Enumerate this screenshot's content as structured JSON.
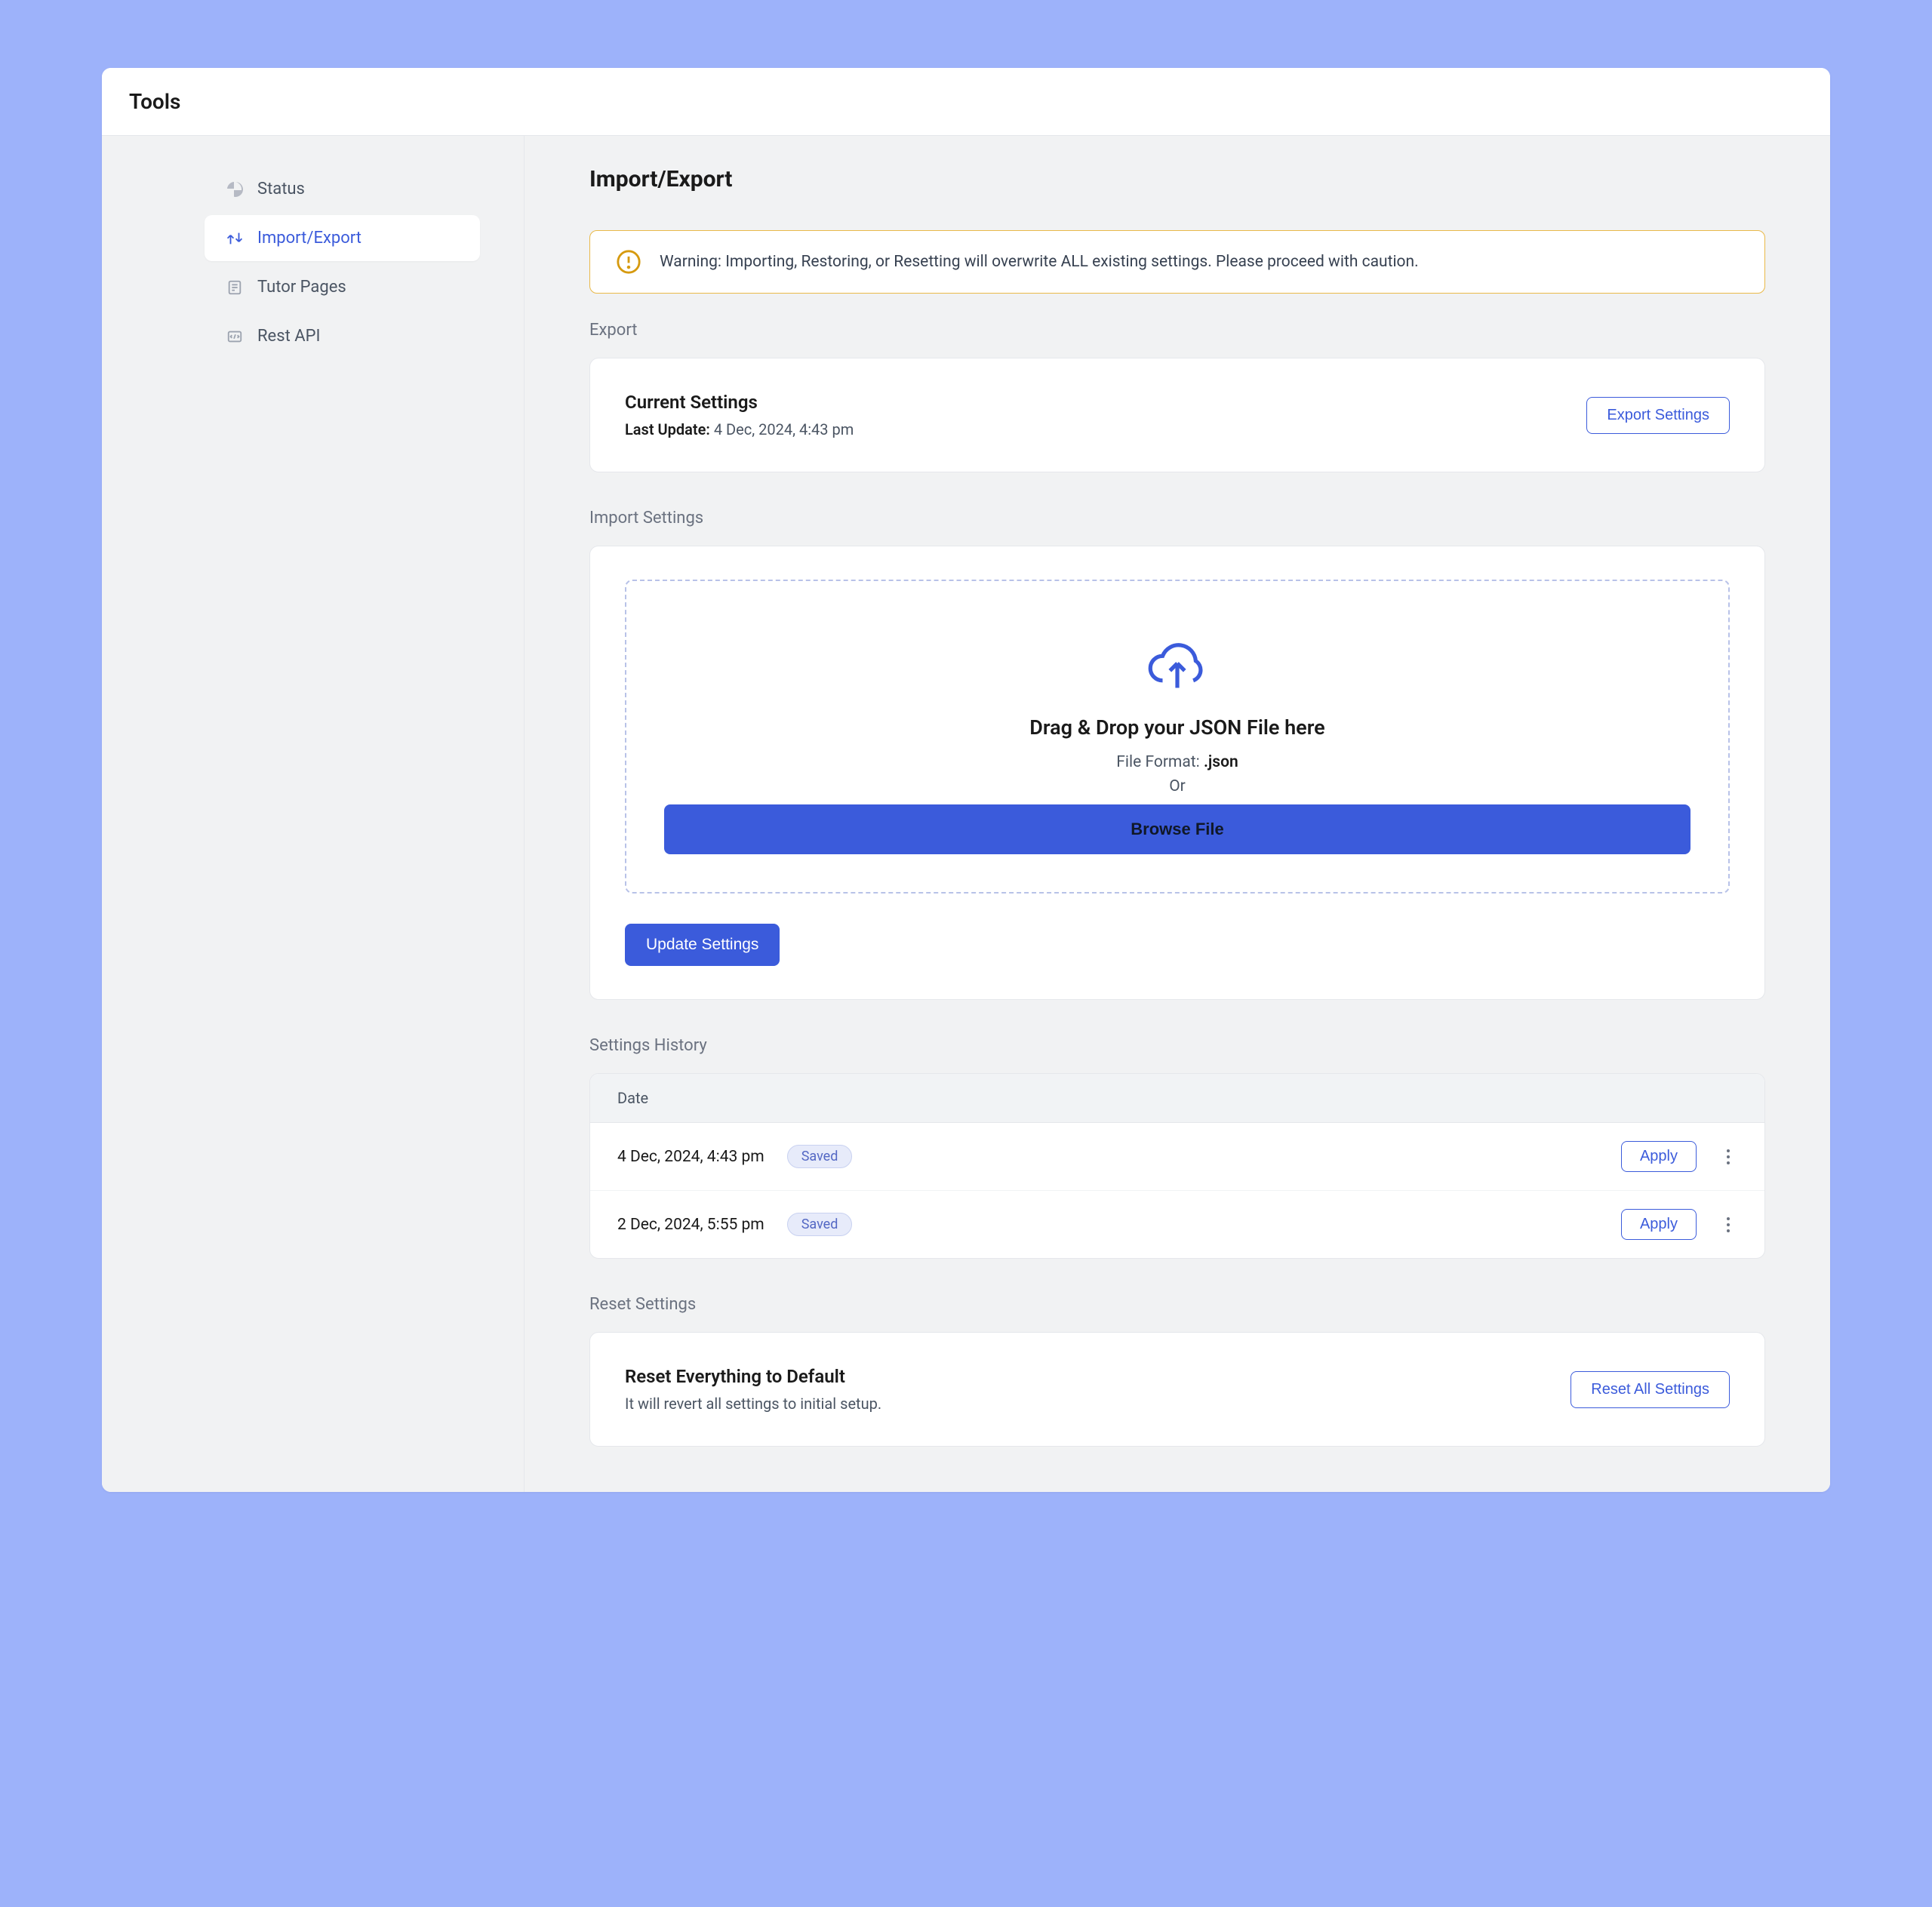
{
  "header": {
    "title": "Tools"
  },
  "sidebar": {
    "items": [
      {
        "label": "Status"
      },
      {
        "label": "Import/Export"
      },
      {
        "label": "Tutor Pages"
      },
      {
        "label": "Rest API"
      }
    ]
  },
  "main": {
    "title": "Import/Export",
    "warning": "Warning: Importing, Restoring, or Resetting will overwrite ALL existing settings. Please proceed with caution."
  },
  "export": {
    "section_title": "Export",
    "card_title": "Current Settings",
    "last_update_label": "Last Update:",
    "last_update_value": "4 Dec, 2024, 4:43 pm",
    "button": "Export Settings"
  },
  "import": {
    "section_title": "Import Settings",
    "dz_title": "Drag & Drop your JSON File here",
    "file_format_label": "File Format:",
    "file_format_value": ".json",
    "or_label": "Or",
    "browse_button": "Browse File",
    "update_button": "Update Settings"
  },
  "history": {
    "section_title": "Settings History",
    "column_date": "Date",
    "rows": [
      {
        "date": "4 Dec, 2024, 4:43 pm",
        "status": "Saved",
        "apply": "Apply"
      },
      {
        "date": "2 Dec, 2024, 5:55 pm",
        "status": "Saved",
        "apply": "Apply"
      }
    ]
  },
  "reset": {
    "section_title": "Reset Settings",
    "card_title": "Reset Everything to Default",
    "card_sub": "It will revert all settings to initial setup.",
    "button": "Reset All Settings"
  }
}
